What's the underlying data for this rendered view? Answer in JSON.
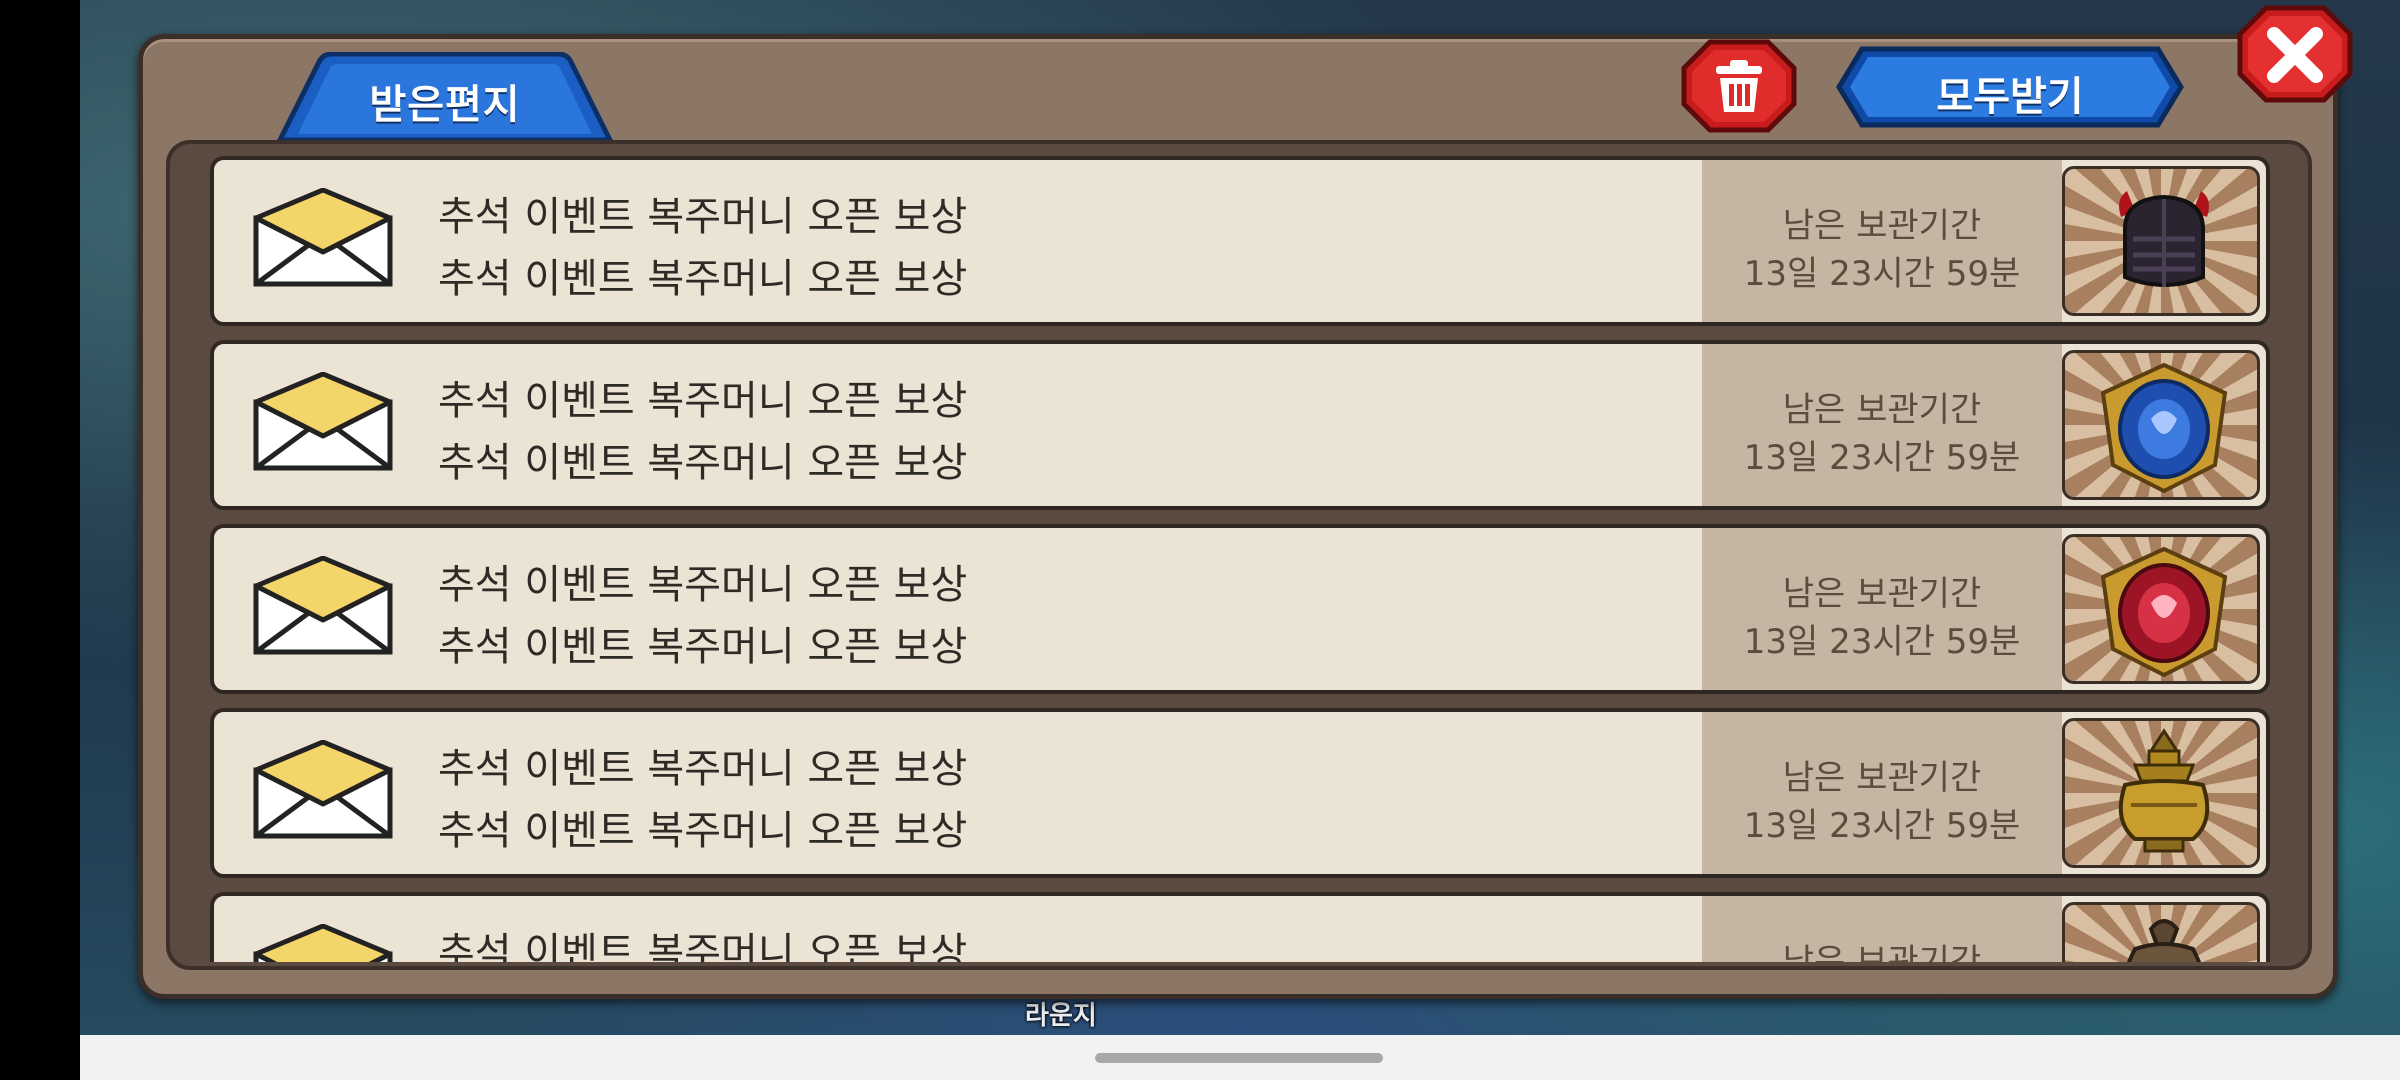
{
  "background": {
    "bottom_label": "라운지"
  },
  "dialog": {
    "tab_label": "받은편지",
    "receive_all_label": "모두받기"
  },
  "mails": [
    {
      "title": "추석 이벤트 복주머니 오픈 보상",
      "body": "추석 이벤트 복주머니 오픈 보상",
      "expire_label": "남은 보관기간",
      "expire_time": "13일 23시간 59분",
      "reward_icon": "dark-helmet-icon"
    },
    {
      "title": "추석 이벤트 복주머니 오픈 보상",
      "body": "추석 이벤트 복주머니 오픈 보상",
      "expire_label": "남은 보관기간",
      "expire_time": "13일 23시간 59분",
      "reward_icon": "blue-shield-emblem-icon"
    },
    {
      "title": "추석 이벤트 복주머니 오픈 보상",
      "body": "추석 이벤트 복주머니 오픈 보상",
      "expire_label": "남은 보관기간",
      "expire_time": "13일 23시간 59분",
      "reward_icon": "red-shield-emblem-icon"
    },
    {
      "title": "추석 이벤트 복주머니 오픈 보상",
      "body": "추석 이벤트 복주머니 오픈 보상",
      "expire_label": "남은 보관기간",
      "expire_time": "13일 23시간 59분",
      "reward_icon": "gold-vase-icon"
    },
    {
      "title": "추석 이벤트 복주머니 오픈 보상",
      "body": "",
      "expire_label": "남은 보관기간",
      "expire_time": "",
      "reward_icon": "pouch-icon"
    }
  ]
}
